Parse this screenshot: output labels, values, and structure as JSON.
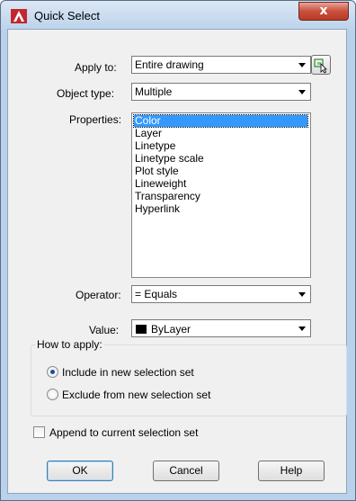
{
  "window": {
    "title": "Quick Select",
    "close_glyph": "x",
    "app_icon": "autocad-a-icon"
  },
  "apply_to": {
    "label": "Apply to:",
    "value": "Entire drawing",
    "pick_icon": "select-objects-icon"
  },
  "object_type": {
    "label": "Object type:",
    "value": "Multiple"
  },
  "properties": {
    "label": "Properties:",
    "items": [
      "Color",
      "Layer",
      "Linetype",
      "Linetype scale",
      "Plot style",
      "Lineweight",
      "Transparency",
      "Hyperlink"
    ],
    "selected_index": 0
  },
  "operator": {
    "label": "Operator:",
    "value": "= Equals"
  },
  "value_field": {
    "label": "Value:",
    "value": "ByLayer",
    "swatch_color": "#000000"
  },
  "how_to_apply": {
    "title": "How to apply:",
    "include_label": "Include in new selection set",
    "exclude_label": "Exclude from new selection set",
    "selected": "include"
  },
  "append": {
    "label": "Append to current selection set",
    "checked": false
  },
  "buttons": {
    "ok": "OK",
    "cancel": "Cancel",
    "help": "Help"
  }
}
